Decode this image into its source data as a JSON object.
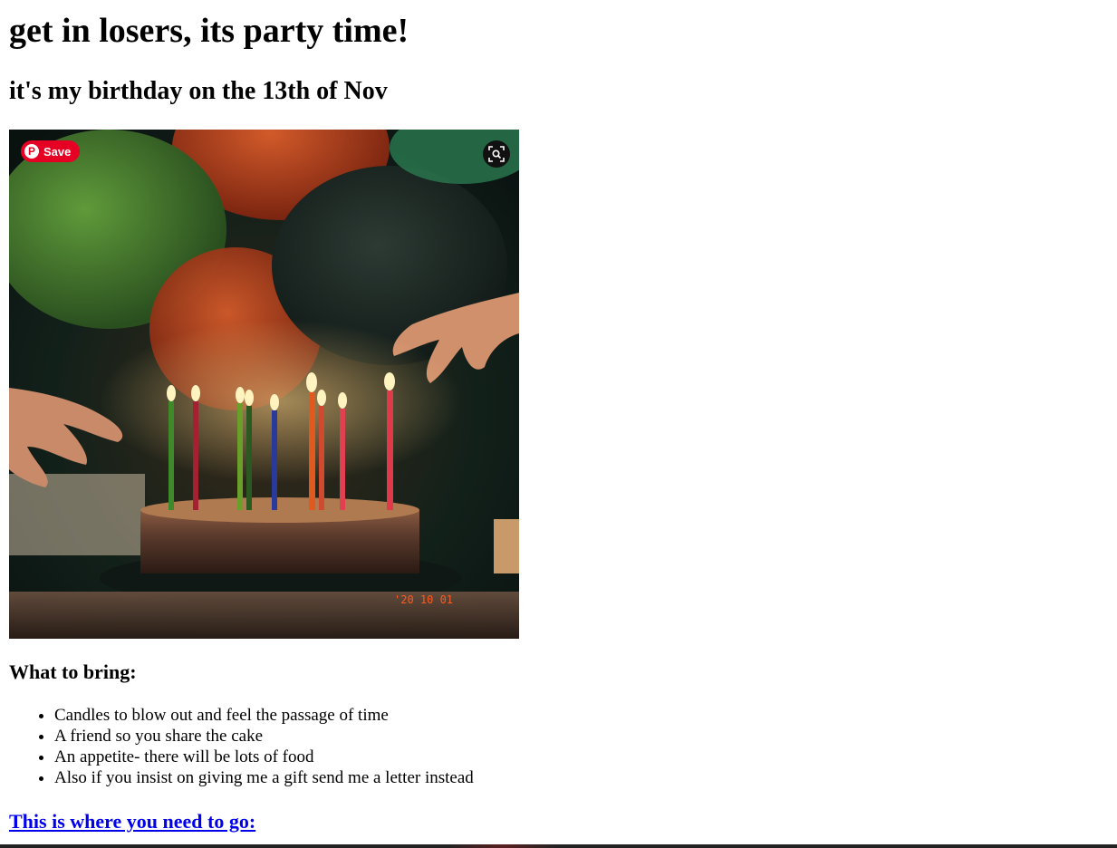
{
  "header": {
    "title": "get in losers, its party time!",
    "subtitle": "it's my birthday on the 13th of Nov"
  },
  "photo": {
    "save_button_label": "Save",
    "pin_logo_glyph": "P",
    "date_stamp": "'20 10 01",
    "save_color": "#e60023"
  },
  "bring": {
    "heading": "What to bring:",
    "items": [
      "Candles to blow out and feel the passage of time",
      "A friend so you share the cake",
      "An appetite- there will be lots of food",
      "Also if you insist on giving me a gift send me a letter instead"
    ]
  },
  "destination": {
    "link_text": "This is where you need to go:",
    "link_color": "#0000ee"
  }
}
